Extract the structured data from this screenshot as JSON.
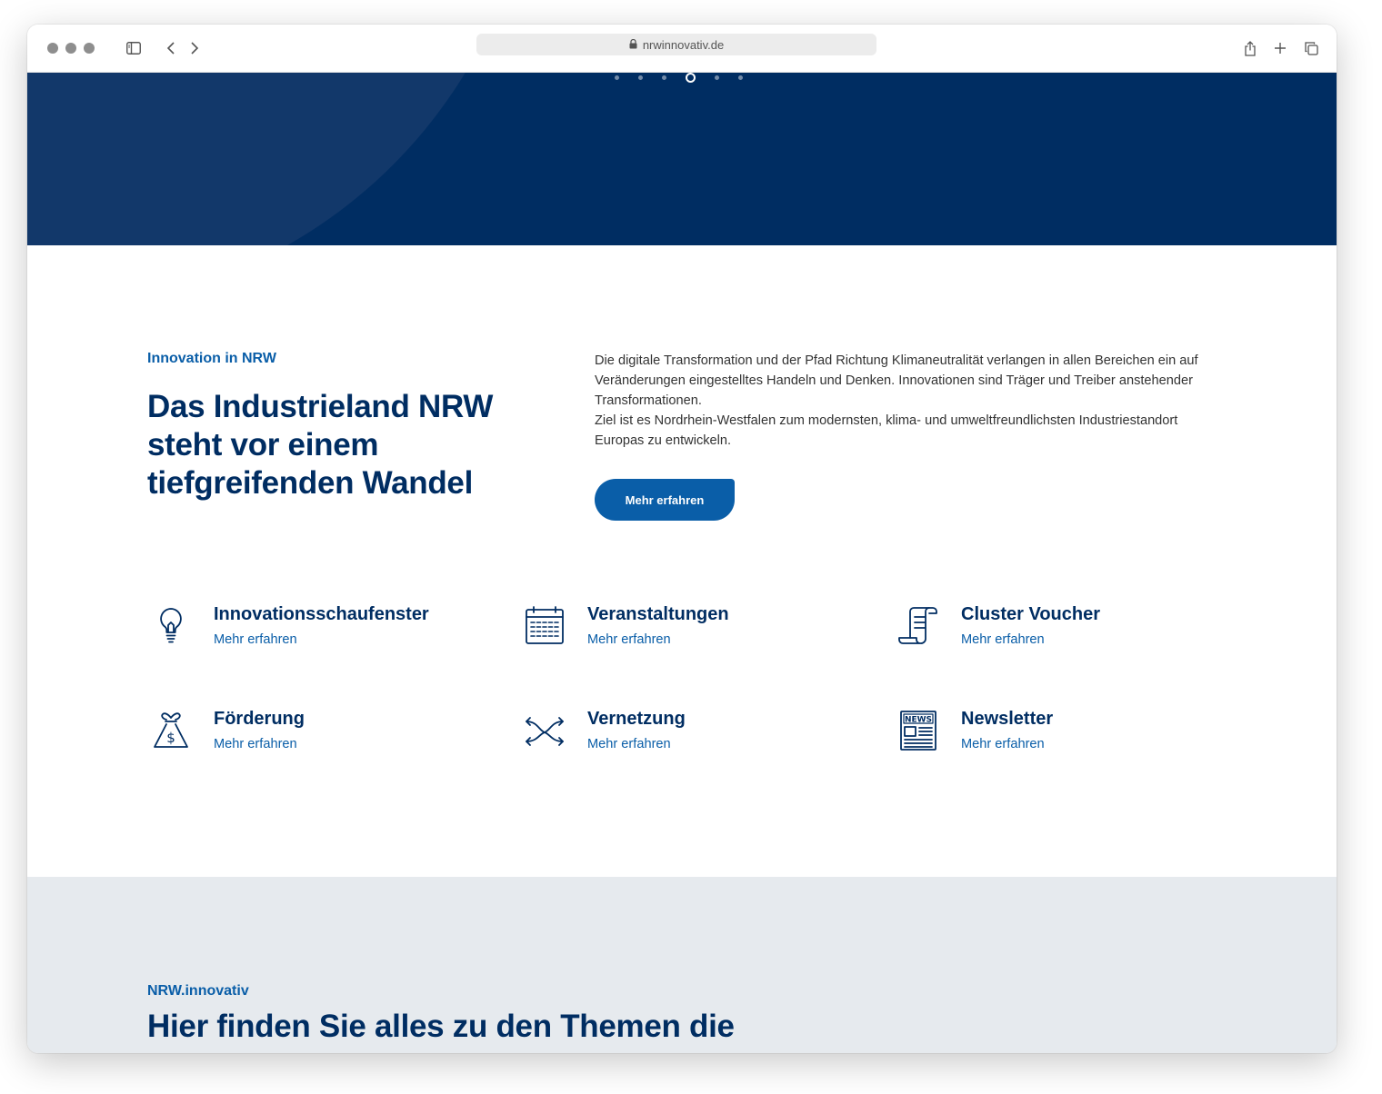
{
  "browser": {
    "url": "nrwinnovativ.de",
    "icons": [
      "sidebar-icon",
      "back-icon",
      "forward-icon",
      "lock-icon",
      "share-icon",
      "new-tab-icon",
      "tabs-overview-icon"
    ]
  },
  "hero": {
    "carousel_dots": 6,
    "active_dot": 4,
    "colors": {
      "background": "#002d62",
      "circle": "#12386a"
    }
  },
  "intro": {
    "eyebrow": "Innovation in NRW",
    "headline": "Das Industrieland NRW steht vor einem tiefgreifenden Wandel",
    "paragraph1": "Die digitale Transformation und der Pfad Richtung Klimaneutralität verlangen in allen Bereichen ein auf Veränderungen eingestelltes Handeln und Denken. Innovationen sind Träger und Treiber anstehender Transformationen.",
    "paragraph2": "Ziel ist es Nordrhein-Westfalen zum modernsten, klima- und umweltfreundlichsten Industriestandort Europas zu entwickeln.",
    "cta_label": "Mehr erfahren"
  },
  "features": [
    {
      "title": "Innovationsschaufenster",
      "link": "Mehr erfahren",
      "icon": "lightbulb-icon"
    },
    {
      "title": "Veranstaltungen",
      "link": "Mehr erfahren",
      "icon": "calendar-icon"
    },
    {
      "title": "Cluster Voucher",
      "link": "Mehr erfahren",
      "icon": "document-scroll-icon"
    },
    {
      "title": "Förderung",
      "link": "Mehr erfahren",
      "icon": "money-bag-icon"
    },
    {
      "title": "Vernetzung",
      "link": "Mehr erfahren",
      "icon": "crossing-arrows-icon"
    },
    {
      "title": "Newsletter",
      "link": "Mehr erfahren",
      "icon": "newspaper-icon"
    }
  ],
  "section2": {
    "eyebrow": "NRW.innovativ",
    "headline": "Hier finden Sie alles zu den Themen die"
  },
  "colors": {
    "primary": "#002d62",
    "accent": "#0a5ea8",
    "grey_section": "#e6eaee"
  }
}
